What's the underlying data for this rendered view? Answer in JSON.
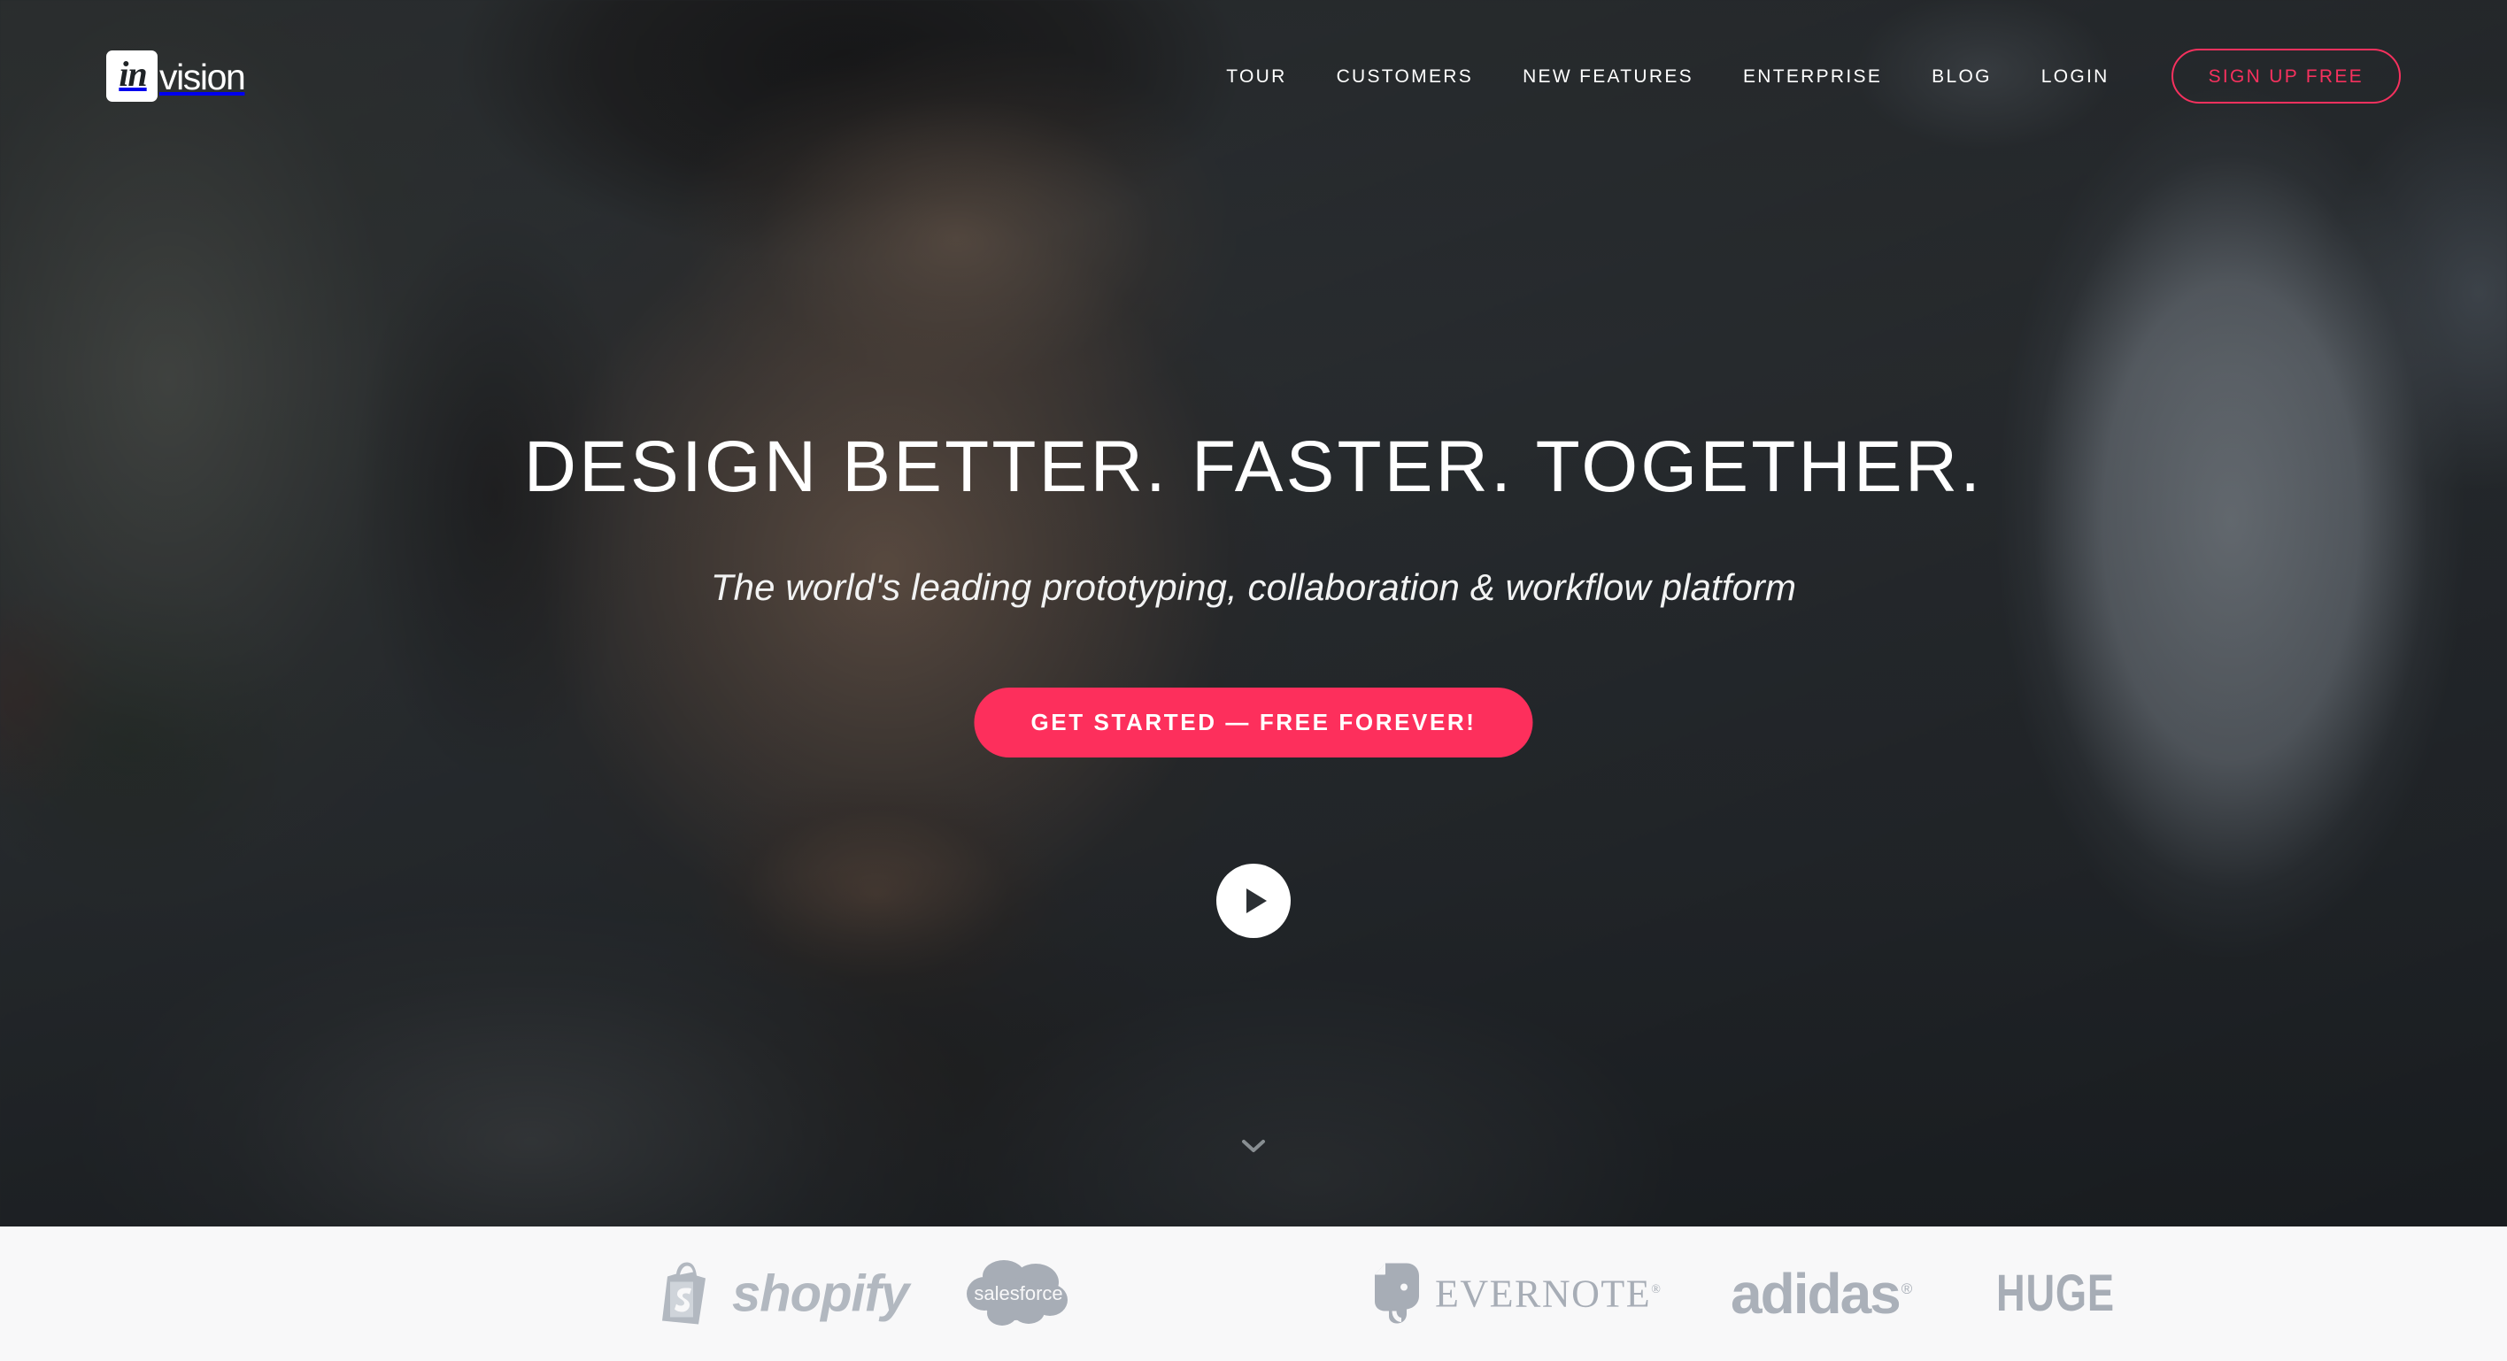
{
  "brand": {
    "logo_mark_text": "in",
    "logo_word": "vision",
    "accent_pink": "#fd2f5c",
    "signup_border_pink": "#f6315e"
  },
  "header": {
    "nav_items": [
      {
        "label": "TOUR",
        "name": "tour"
      },
      {
        "label": "CUSTOMERS",
        "name": "customers"
      },
      {
        "label": "NEW FEATURES",
        "name": "new-features"
      },
      {
        "label": "ENTERPRISE",
        "name": "enterprise"
      },
      {
        "label": "BLOG",
        "name": "blog"
      },
      {
        "label": "LOGIN",
        "name": "login"
      }
    ],
    "signup_label": "SIGN UP FREE"
  },
  "hero": {
    "headline": "DESIGN BETTER. FASTER. TOGETHER.",
    "subheadline": "The world's leading prototyping, collaboration & workflow platform",
    "cta_label": "GET STARTED — FREE FOREVER!",
    "play_icon": "play-icon",
    "scroll_icon": "chevron-down-icon",
    "background_description": "video still of a man's face in an office, darkened"
  },
  "clients": {
    "bar_background": "#f8f8f9",
    "logo_color": "#a7adb6",
    "items": [
      {
        "name": "shopify",
        "label": "shopify"
      },
      {
        "name": "salesforce",
        "label": "salesforce"
      },
      {
        "name": "evernote",
        "label": "EVERNOTE",
        "registered": "®"
      },
      {
        "name": "adidas",
        "label": "adidas",
        "registered": "®"
      },
      {
        "name": "huge",
        "label": "HUGE"
      }
    ]
  }
}
